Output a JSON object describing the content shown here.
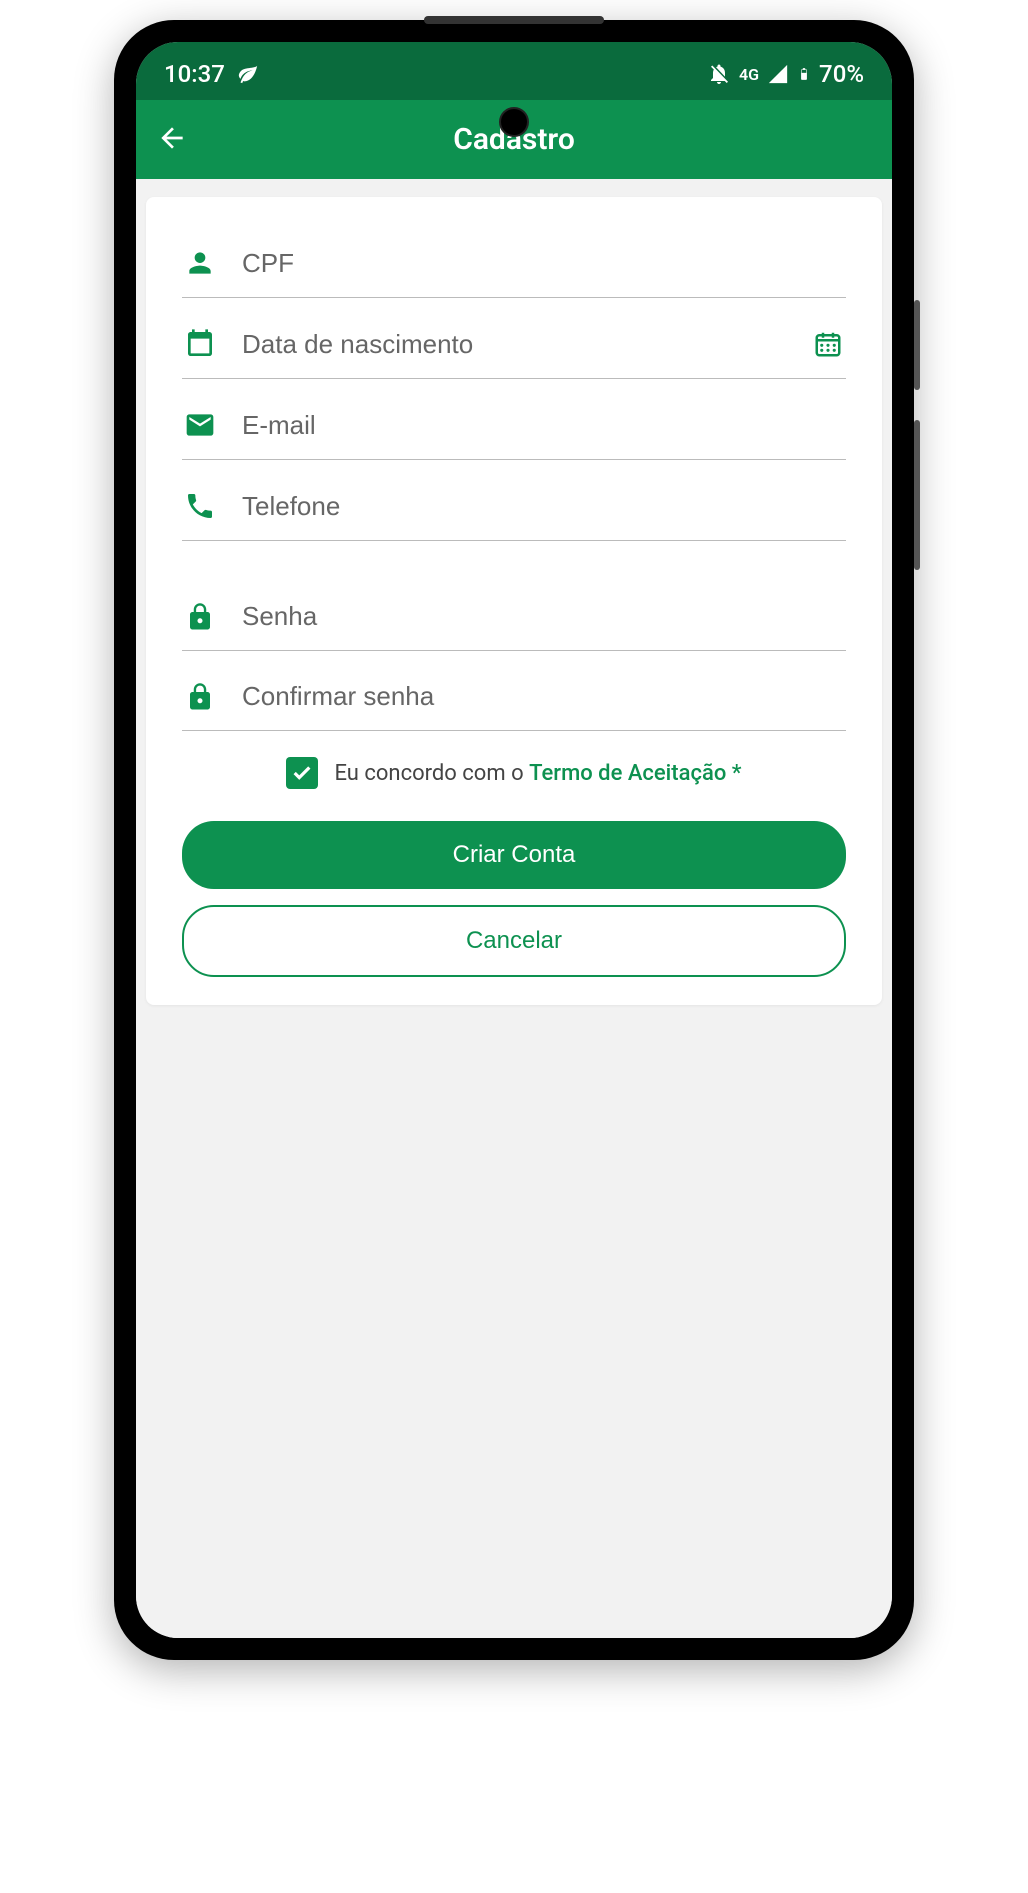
{
  "statusBar": {
    "time": "10:37",
    "network": "4G",
    "battery": "70%"
  },
  "appBar": {
    "title": "Cadastro"
  },
  "fields": {
    "cpf": {
      "placeholder": "CPF"
    },
    "birthdate": {
      "placeholder": "Data de nascimento"
    },
    "email": {
      "placeholder": "E-mail"
    },
    "phone": {
      "placeholder": "Telefone"
    },
    "password": {
      "placeholder": "Senha"
    },
    "confirmPassword": {
      "placeholder": "Confirmar senha"
    }
  },
  "terms": {
    "prefix": "Eu concordo com o ",
    "link": "Termo de Aceitação *",
    "checked": true
  },
  "buttons": {
    "create": "Criar Conta",
    "cancel": "Cancelar"
  },
  "colors": {
    "primary": "#0d9150",
    "primaryDark": "#0a6b3d"
  }
}
